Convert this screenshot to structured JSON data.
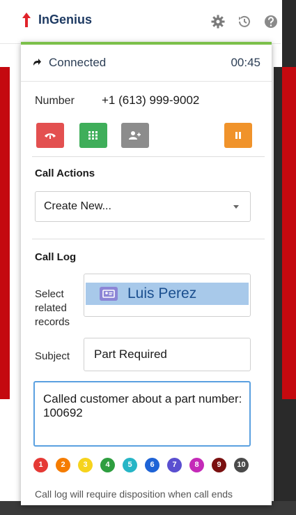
{
  "app": {
    "title": "InGenius"
  },
  "colors": {
    "brand_red": "#c4090f",
    "connected_green": "#7cc04b",
    "hangup_red": "#e35050",
    "keypad_green": "#3fae5a",
    "transfer_gray": "#8c8c8c",
    "hold_orange": "#f0932b",
    "focus_blue": "#5aa0e0"
  },
  "header_icons": [
    "gear-icon",
    "history-icon",
    "help-icon"
  ],
  "status": {
    "text": "Connected",
    "timer": "00:45"
  },
  "number": {
    "label": "Number",
    "value": "+1 (613) 999-9002"
  },
  "controls": [
    "hangup-icon",
    "keypad-icon",
    "add-contact-icon",
    "pause-icon"
  ],
  "call_actions": {
    "title": "Call Actions",
    "selected": "Create New..."
  },
  "call_log": {
    "title": "Call Log",
    "related_label": "Select related records",
    "related_value": "Luis Perez",
    "subject_label": "Subject",
    "subject_value": "Part Required",
    "notes": "Called customer about a part number: 100692"
  },
  "dispositions": [
    {
      "label": "1",
      "color": "#e53935"
    },
    {
      "label": "2",
      "color": "#f57c00"
    },
    {
      "label": "3",
      "color": "#f6d31c"
    },
    {
      "label": "4",
      "color": "#2e9e3f"
    },
    {
      "label": "5",
      "color": "#26b5c6"
    },
    {
      "label": "6",
      "color": "#1e63d6"
    },
    {
      "label": "7",
      "color": "#5a4fd0"
    },
    {
      "label": "8",
      "color": "#c42ab8"
    },
    {
      "label": "9",
      "color": "#7a1010"
    },
    {
      "label": "10",
      "color": "#4a4a4a"
    }
  ],
  "footnote": "Call log will require disposition when call ends"
}
